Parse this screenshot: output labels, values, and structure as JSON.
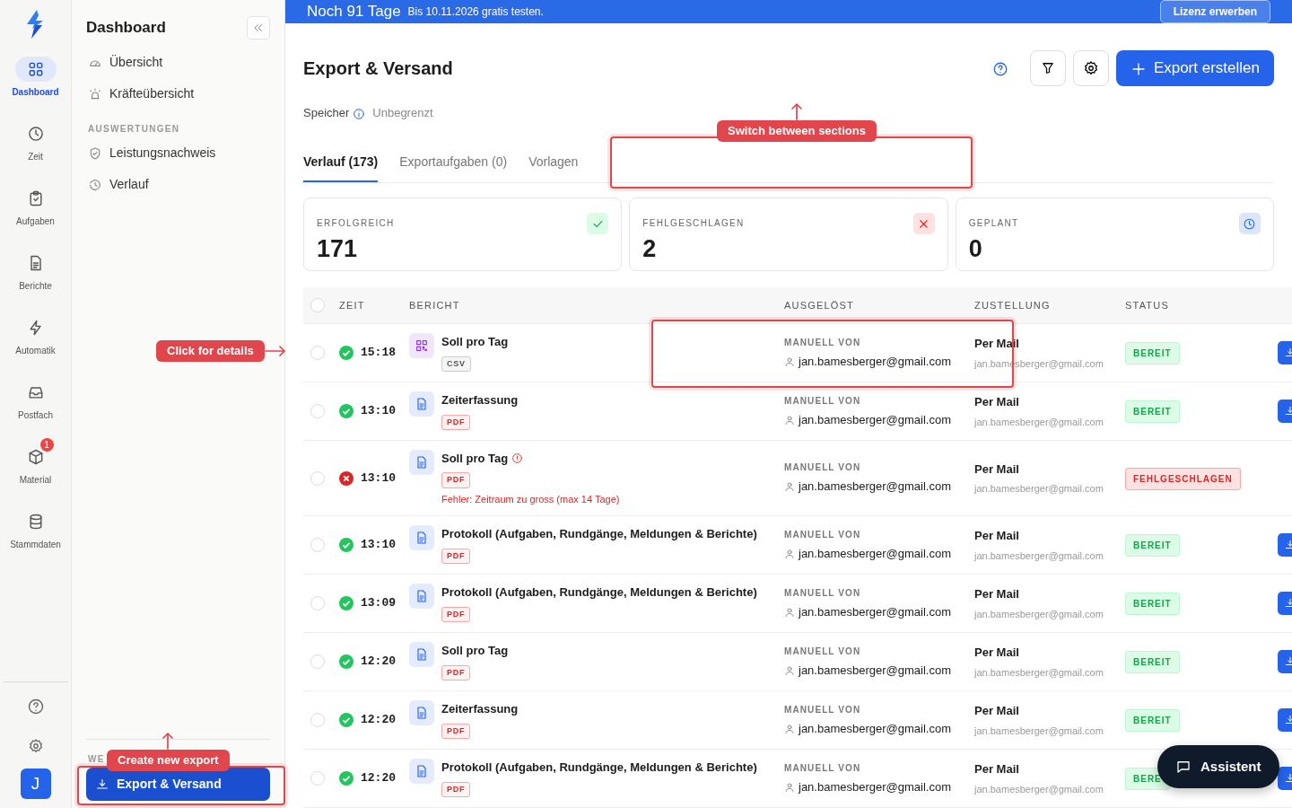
{
  "banner": {
    "title": "Noch 91 Tage",
    "text": "Bis 10.11.2026 gratis testen.",
    "button": "Lizenz erwerben"
  },
  "rail": {
    "items": [
      {
        "label": "Dashboard",
        "selected": true
      },
      {
        "label": "Zeit",
        "selected": false
      },
      {
        "label": "Aufgaben",
        "selected": false
      },
      {
        "label": "Berichte",
        "selected": false
      },
      {
        "label": "Automatik",
        "selected": false
      },
      {
        "label": "Postfach",
        "selected": false
      },
      {
        "label": "Material",
        "selected": false,
        "badge": "1"
      },
      {
        "label": "Stammdaten",
        "selected": false
      }
    ],
    "avatar": "J"
  },
  "sidebar": {
    "title": "Dashboard",
    "items": [
      {
        "label": "Übersicht",
        "selected": false
      },
      {
        "label": "Kräfteübersicht",
        "selected": false
      }
    ],
    "sections": [
      {
        "heading": "AUSWERTUNGEN",
        "items": [
          {
            "label": "Leistungsnachweis",
            "selected": false
          },
          {
            "label": "Verlauf",
            "selected": false
          }
        ]
      }
    ],
    "bottom": {
      "heading": "WE",
      "item": {
        "label": "Export & Versand",
        "selected": true
      }
    }
  },
  "page": {
    "title": "Export & Versand",
    "primary_button": "Export erstellen",
    "storage_label": "Speicher",
    "storage_value": "Unbegrenzt"
  },
  "tabs": [
    {
      "label": "Verlauf (173)",
      "selected": true
    },
    {
      "label": "Exportaufgaben (0)",
      "selected": false
    },
    {
      "label": "Vorlagen",
      "selected": false
    }
  ],
  "stats": [
    {
      "label": "ERFOLGREICH",
      "value": "171",
      "kind": "success"
    },
    {
      "label": "FEHLGESCHLAGEN",
      "value": "2",
      "kind": "failed"
    },
    {
      "label": "GEPLANT",
      "value": "0",
      "kind": "planned"
    }
  ],
  "table": {
    "all_checked": false,
    "columns": [
      "ZEIT",
      "BERICHT",
      "AUSGELÖST",
      "ZUSTELLUNG",
      "STATUS"
    ],
    "rows": [
      {
        "checked": false,
        "kind": "success",
        "time": "15:18",
        "report": "Soll pro Tag",
        "format": {
          "label": "CSV",
          "kind": "csv"
        },
        "trigger_label": "MANUELL VON",
        "user": "jan.bamesberger@gmail.com",
        "delivery": "Per Mail",
        "delivery_to": "jan.bamesberger@gmail.com",
        "status": "BEREIT"
      },
      {
        "checked": false,
        "kind": "success",
        "time": "13:10",
        "report": "Zeiterfassung",
        "format": {
          "label": "PDF",
          "kind": "pdf"
        },
        "trigger_label": "MANUELL VON",
        "user": "jan.bamesberger@gmail.com",
        "delivery": "Per Mail",
        "delivery_to": "jan.bamesberger@gmail.com",
        "status": "BEREIT"
      },
      {
        "checked": false,
        "kind": "failed",
        "time": "13:10",
        "report": "Soll pro Tag",
        "format": {
          "label": "PDF",
          "kind": "pdf"
        },
        "error": "Fehler: Zeitraum zu gross (max 14 Tage)",
        "trigger_label": "MANUELL VON",
        "user": "jan.bamesberger@gmail.com",
        "delivery": "Per Mail",
        "delivery_to": "jan.bamesberger@gmail.com",
        "status": "FEHLGESCHLAGEN"
      },
      {
        "checked": false,
        "kind": "success",
        "time": "13:10",
        "report": "Protokoll (Aufgaben, Rundgänge, Meldungen & Berichte)",
        "format": {
          "label": "PDF",
          "kind": "pdf"
        },
        "trigger_label": "MANUELL VON",
        "user": "jan.bamesberger@gmail.com",
        "delivery": "Per Mail",
        "delivery_to": "jan.bamesberger@gmail.com",
        "status": "BEREIT"
      },
      {
        "checked": false,
        "kind": "success",
        "time": "13:09",
        "report": "Protokoll (Aufgaben, Rundgänge, Meldungen & Berichte)",
        "format": {
          "label": "PDF",
          "kind": "pdf"
        },
        "trigger_label": "MANUELL VON",
        "user": "jan.bamesberger@gmail.com",
        "delivery": "Per Mail",
        "delivery_to": "jan.bamesberger@gmail.com",
        "status": "BEREIT"
      },
      {
        "checked": false,
        "kind": "success",
        "time": "12:20",
        "report": "Soll pro Tag",
        "format": {
          "label": "PDF",
          "kind": "pdf"
        },
        "trigger_label": "MANUELL VON",
        "user": "jan.bamesberger@gmail.com",
        "delivery": "Per Mail",
        "delivery_to": "jan.bamesberger@gmail.com",
        "status": "BEREIT"
      },
      {
        "checked": false,
        "kind": "success",
        "time": "12:20",
        "report": "Zeiterfassung",
        "format": {
          "label": "PDF",
          "kind": "pdf"
        },
        "trigger_label": "MANUELL VON",
        "user": "jan.bamesberger@gmail.com",
        "delivery": "Per Mail",
        "delivery_to": "jan.bamesberger@gmail.com",
        "status": "BEREIT"
      },
      {
        "checked": false,
        "kind": "success",
        "time": "12:20",
        "report": "Protokoll (Aufgaben, Rundgänge, Meldungen & Berichte)",
        "format": {
          "label": "PDF",
          "kind": "pdf"
        },
        "trigger_label": "MANUELL VON",
        "user": "jan.bamesberger@gmail.com",
        "delivery": "Per Mail",
        "delivery_to": "jan.bamesberger@gmail.com",
        "status": "BERE"
      }
    ]
  },
  "assistant_button": "Assistent",
  "annotations": [
    {
      "text": "Switch between sections",
      "kind": "up"
    },
    {
      "text": "Click for details",
      "kind": "right"
    },
    {
      "text": "Create new export",
      "kind": "up"
    }
  ]
}
